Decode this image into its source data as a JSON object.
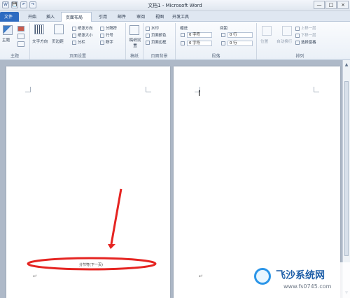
{
  "window": {
    "title": "文档1 - Microsoft Word",
    "quick_access": [
      "W",
      "保存",
      "撤销",
      "恢复"
    ],
    "controls": [
      "—",
      "□",
      "×"
    ]
  },
  "tabs": {
    "file": "文件",
    "items": [
      "开始",
      "插入",
      "页面布局",
      "引用",
      "邮件",
      "审阅",
      "视图",
      "开发工具"
    ],
    "active": "页面布局"
  },
  "ribbon": {
    "themes": {
      "label": "主题",
      "theme": "主题"
    },
    "page_setup": {
      "label": "页面设置",
      "buttons": [
        "文字方向",
        "页边距",
        "纸张方向",
        "纸张大小",
        "分栏",
        "分隔符",
        "行号",
        "断字"
      ]
    },
    "draft": {
      "label": "稿纸",
      "button": "稿纸设置"
    },
    "page_background": {
      "label": "页面背景",
      "buttons": [
        "水印",
        "页面颜色",
        "页面边框"
      ]
    },
    "paragraph": {
      "label": "段落",
      "indent_label": "缩进",
      "spacing_label": "间距",
      "left": "0 字符",
      "right": "0 字符",
      "before": "0 行",
      "after": "0 行"
    },
    "arrange": {
      "label": "排列",
      "buttons": [
        "位置",
        "自动换行",
        "上移一层",
        "下移一层",
        "选择窗格"
      ]
    }
  },
  "document": {
    "footer_text": "分节符(下一页)",
    "return_mark": "↵"
  },
  "watermark": {
    "title": "飞沙系统网",
    "url": "www.fs0745.com"
  }
}
